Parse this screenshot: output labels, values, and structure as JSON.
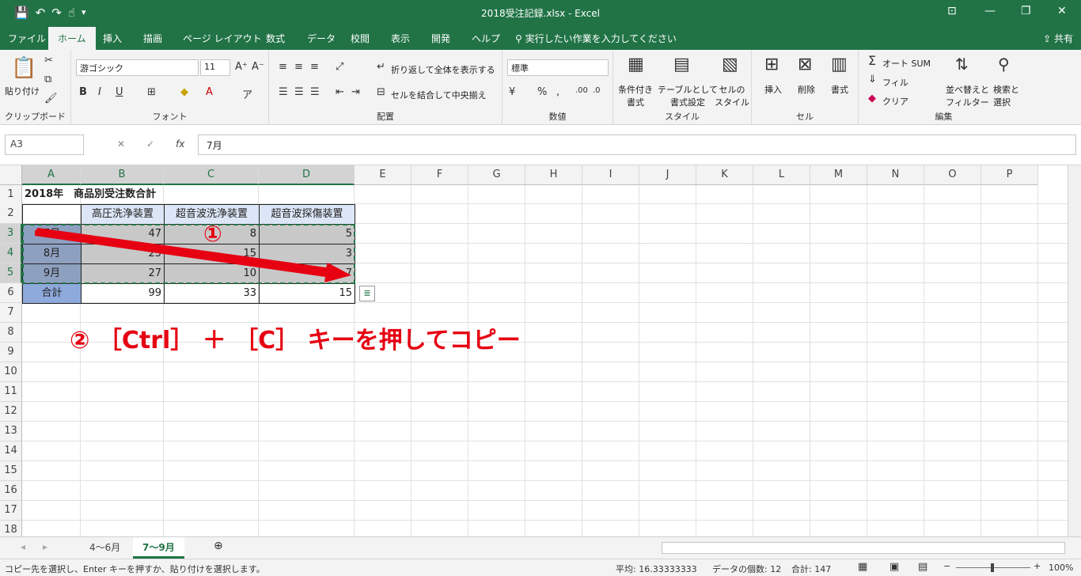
{
  "titlebar": {
    "title": "2018受注記録.xlsx  -  Excel",
    "qat": [
      "💾",
      "↶",
      "↷",
      "☝",
      "▾"
    ],
    "minimize": "—",
    "restore": "❐",
    "close": "✕",
    "ribbon_opt": "⊡"
  },
  "tabs": [
    "ファイル",
    "ホーム",
    "挿入",
    "描画",
    "ページ レイアウト",
    "数式",
    "データ",
    "校閲",
    "表示",
    "開発",
    "ヘルプ"
  ],
  "tellme": "実行したい作業を入力してください",
  "share": "共有",
  "ribbon": {
    "clipboard": {
      "paste": "貼り付け",
      "label": "クリップボード"
    },
    "font": {
      "name": "游ゴシック",
      "size": "11",
      "label": "フォント",
      "bold": "B",
      "italic": "I",
      "underline": "U"
    },
    "align": {
      "wrap": "折り返して全体を表示する",
      "merge": "セルを結合して中央揃え",
      "label": "配置"
    },
    "number": {
      "format": "標準",
      "label": "数値",
      "percent": "%"
    },
    "styles": {
      "cond": "条件付き\n書式",
      "table": "テーブルとして\n書式設定",
      "cell": "セルの\nスタイル",
      "label": "スタイル"
    },
    "cells": {
      "insert": "挿入",
      "delete": "削除",
      "format": "書式",
      "label": "セル"
    },
    "editing": {
      "autosum": "オート SUM",
      "fill": "フィル",
      "clear": "クリア",
      "sort": "並べ替えと\nフィルター",
      "find": "検索と\n選択",
      "label": "編集"
    }
  },
  "formula": {
    "namebox": "A3",
    "value": "7月"
  },
  "columns": [
    "A",
    "B",
    "C",
    "D",
    "E",
    "F",
    "G",
    "H",
    "I",
    "J",
    "K",
    "L",
    "M",
    "N",
    "O",
    "P"
  ],
  "rows": [
    "1",
    "2",
    "3",
    "4",
    "5",
    "6",
    "7",
    "8",
    "9",
    "10",
    "11",
    "12",
    "13",
    "14",
    "15",
    "16",
    "17",
    "18"
  ],
  "table": {
    "title": "2018年　商品別受注数合計",
    "headers": [
      "高圧洗浄装置",
      "超音波洗浄装置",
      "超音波探傷装置"
    ],
    "months": [
      "7月",
      "8月",
      "9月",
      "合計"
    ],
    "values": [
      [
        "47",
        "8",
        "5"
      ],
      [
        "25",
        "15",
        "3"
      ],
      [
        "27",
        "10",
        "7"
      ],
      [
        "99",
        "33",
        "15"
      ]
    ]
  },
  "annotation": {
    "circle": "①",
    "text": "② ［Ctrl］ ＋ ［C］ キーを押してコピー"
  },
  "sheet_tabs": [
    "4～6月",
    "7～9月"
  ],
  "status": {
    "message": "コピー先を選択し、Enter キーを押すか、貼り付けを選択します。",
    "average": "平均: 16.33333333",
    "count": "データの個数: 12",
    "sum": "合計: 147",
    "zoom": "100%"
  },
  "colors": {
    "accent": "#217346",
    "annotation": "#e60012",
    "header_fill": "#dce6f6",
    "month_fill": "#8ea9db"
  }
}
